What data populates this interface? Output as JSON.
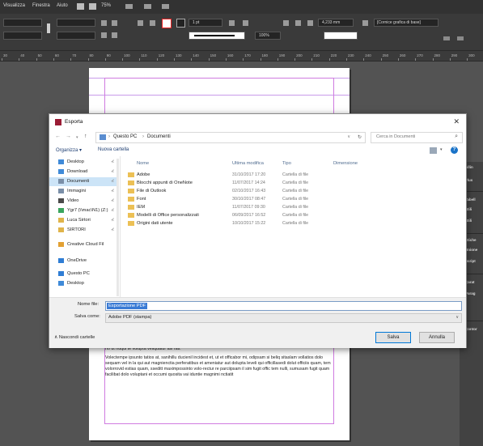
{
  "menubar": {
    "items": [
      "Visualizza",
      "Finestra",
      "Aiuto"
    ],
    "zoom": "75%"
  },
  "toolbar": {
    "stroke": "1 pt",
    "percent": "100%",
    "dimension": "4,233 mm",
    "style": "[Cornice grafica di base]"
  },
  "ruler": {
    "marks": [
      "30",
      "40",
      "50",
      "60",
      "70",
      "80",
      "90",
      "100",
      "110",
      "120",
      "130",
      "140",
      "150",
      "160",
      "170",
      "180",
      "190",
      "200",
      "210",
      "220",
      "230",
      "240",
      "250",
      "260",
      "270",
      "280",
      "290",
      "300"
    ]
  },
  "document": {
    "top_line": "ho ut nuqui te volupta veliquatur asi rati.",
    "paragraph": "Volectempe ipsunto tatios at, sanihillu ducienil incidest et, ut et officabor mi, odipsam si beliq sitaslam vollatios dolo sequam vel in la qui aut magnienctia perferatibus et ameniatur aut dolupta leveli qui officillasedi dolut officiis quam, tem volorrovid estias quam, sseditt maximpossinto volo-rectur re parciipsam il sim fugit offic tem nulli, sumusam fugit quam facilibat dolo voluptani et occumi quosita vai iduntie magnimi nctiatit"
  },
  "right_panel": {
    "items": [
      "Allin",
      "Flus",
      "Tabell",
      "Stili",
      "Stili",
      "Etiche",
      "Unione",
      "Script",
      "Carat",
      "Parag",
      "Contor"
    ]
  },
  "dialog": {
    "title": "Esporta",
    "close": "✕",
    "nav": {
      "back": "←",
      "forward": "→",
      "up": "↑"
    },
    "breadcrumb": [
      "Questo PC",
      "Documenti"
    ],
    "search_placeholder": "Cerca in Documenti",
    "commands": {
      "organize": "Organizza ▾",
      "new_folder": "Nuova cartella"
    },
    "sidebar": [
      {
        "label": "Desktop",
        "pinned": true,
        "color": "#3f8ad8"
      },
      {
        "label": "Download",
        "pinned": true,
        "color": "#3f8ad8"
      },
      {
        "label": "Documenti",
        "pinned": true,
        "color": "#7a8fa8",
        "selected": true
      },
      {
        "label": "Immagini",
        "pinned": true,
        "color": "#7a8fa8"
      },
      {
        "label": "Video",
        "pinned": true,
        "color": "#4a4a4a"
      },
      {
        "label": "Ygr7 (\\\\mac\\N1) (Z:)",
        "pinned": true,
        "color": "#3aa55d"
      },
      {
        "label": "Luca Sirtori",
        "pinned": true,
        "color": "#e0b44a"
      },
      {
        "label": "SIRTORI",
        "pinned": true,
        "color": "#e0b44a"
      },
      {
        "label": "Creative Cloud Fil",
        "pinned": false,
        "color": "#e2a033"
      },
      {
        "label": "OneDrive",
        "pinned": false,
        "color": "#2f7dd4"
      },
      {
        "label": "Questo PC",
        "pinned": false,
        "color": "#2f7dd4"
      },
      {
        "label": "Desktop",
        "pinned": false,
        "color": "#3f8ad8"
      }
    ],
    "columns": [
      "Nome",
      "Ultima modifica",
      "Tipo",
      "Dimensione"
    ],
    "files": [
      {
        "name": "Adobe",
        "modified": "31/10/2017 17:20",
        "type": "Cartella di file"
      },
      {
        "name": "Blocchi appunti di OneNote",
        "modified": "11/07/2017 14:24",
        "type": "Cartella di file"
      },
      {
        "name": "File di Outlook",
        "modified": "02/10/2017 16:43",
        "type": "Cartella di file"
      },
      {
        "name": "Font",
        "modified": "30/10/2017 08:47",
        "type": "Cartella di file"
      },
      {
        "name": "IEM",
        "modified": "11/07/2017 09:30",
        "type": "Cartella di file"
      },
      {
        "name": "Modelli di Office personalizzati",
        "modified": "06/09/2017 16:52",
        "type": "Cartella di file"
      },
      {
        "name": "Origini dati utente",
        "modified": "10/10/2017 15:22",
        "type": "Cartella di file"
      }
    ],
    "filename_label": "Nome file:",
    "filename_value": "Esportazione PDF",
    "savetype_label": "Salva come:",
    "savetype_value": "Adobe PDF (stampa)",
    "hide_folders": "Nascondi cartelle",
    "save_button": "Salva",
    "cancel_button": "Annulla"
  }
}
